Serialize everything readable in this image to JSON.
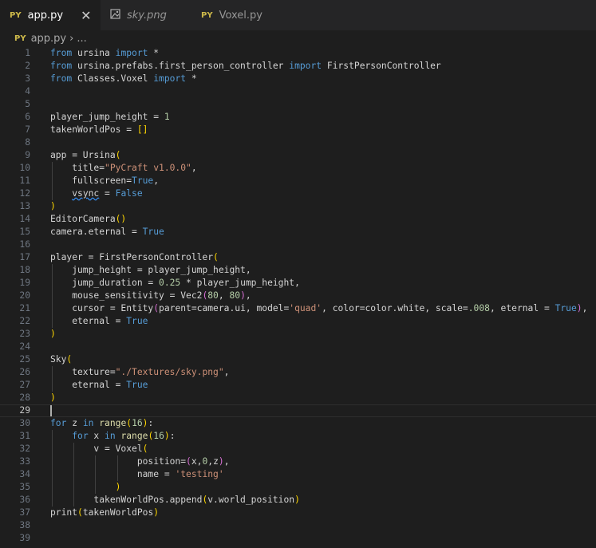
{
  "tabs": [
    {
      "icon": "PY",
      "label": "app.py",
      "active": true,
      "close": "✕"
    },
    {
      "icon": "image",
      "label": "sky.png",
      "active": false
    },
    {
      "icon": "PY",
      "label": "Voxel.py",
      "active": false
    }
  ],
  "breadcrumb": {
    "icon": "PY",
    "file": "app.py",
    "chevron": "›",
    "rest": "..."
  },
  "colors": {
    "keyword": "#569cd6",
    "string": "#ce9178",
    "number": "#b5cea8",
    "bracket": "#ffd700"
  },
  "current_line": 29,
  "lines": [
    {
      "n": "1",
      "tokens": [
        [
          "kw",
          "from"
        ],
        [
          "n",
          " ursina "
        ],
        [
          "kw",
          "import"
        ],
        [
          "n",
          " *"
        ]
      ]
    },
    {
      "n": "2",
      "tokens": [
        [
          "kw",
          "from"
        ],
        [
          "n",
          " ursina.prefabs.first_person_controller "
        ],
        [
          "kw",
          "import"
        ],
        [
          "n",
          " FirstPersonController"
        ]
      ]
    },
    {
      "n": "3",
      "tokens": [
        [
          "kw",
          "from"
        ],
        [
          "n",
          " Classes.Voxel "
        ],
        [
          "kw",
          "import"
        ],
        [
          "n",
          " *"
        ]
      ]
    },
    {
      "n": "4",
      "tokens": []
    },
    {
      "n": "5",
      "tokens": []
    },
    {
      "n": "6",
      "tokens": [
        [
          "n",
          "player_jump_height = "
        ],
        [
          "num",
          "1"
        ]
      ]
    },
    {
      "n": "7",
      "tokens": [
        [
          "n",
          "takenWorldPos = "
        ],
        [
          "p",
          "[]"
        ]
      ]
    },
    {
      "n": "8",
      "tokens": []
    },
    {
      "n": "9",
      "tokens": [
        [
          "n",
          "app = Ursina"
        ],
        [
          "p",
          "("
        ]
      ]
    },
    {
      "n": "10",
      "tokens": [
        [
          "n",
          "    title="
        ],
        [
          "str",
          "\"PyCraft v1.0.0\""
        ],
        [
          "n",
          ","
        ]
      ]
    },
    {
      "n": "11",
      "tokens": [
        [
          "n",
          "    fullscreen="
        ],
        [
          "kw",
          "True"
        ],
        [
          "n",
          ","
        ]
      ]
    },
    {
      "n": "12",
      "tokens": [
        [
          "n",
          "    "
        ],
        [
          "sq",
          "vsync"
        ],
        [
          "n",
          " = "
        ],
        [
          "kw",
          "False"
        ]
      ]
    },
    {
      "n": "13",
      "tokens": [
        [
          "p",
          ")"
        ]
      ]
    },
    {
      "n": "14",
      "tokens": [
        [
          "n",
          "EditorCamera"
        ],
        [
          "p",
          "()"
        ]
      ]
    },
    {
      "n": "15",
      "tokens": [
        [
          "n",
          "camera.eternal = "
        ],
        [
          "kw",
          "True"
        ]
      ]
    },
    {
      "n": "16",
      "tokens": []
    },
    {
      "n": "17",
      "tokens": [
        [
          "n",
          "player = FirstPersonController"
        ],
        [
          "p",
          "("
        ]
      ]
    },
    {
      "n": "18",
      "tokens": [
        [
          "n",
          "    jump_height = player_jump_height,"
        ]
      ]
    },
    {
      "n": "19",
      "tokens": [
        [
          "n",
          "    jump_duration = "
        ],
        [
          "num",
          "0.25"
        ],
        [
          "n",
          " * player_jump_height,"
        ]
      ]
    },
    {
      "n": "20",
      "tokens": [
        [
          "n",
          "    mouse_sensitivity = Vec2"
        ],
        [
          "p2",
          "("
        ],
        [
          "num",
          "80"
        ],
        [
          "n",
          ", "
        ],
        [
          "num",
          "80"
        ],
        [
          "p2",
          ")"
        ],
        [
          "n",
          ","
        ]
      ]
    },
    {
      "n": "21",
      "tokens": [
        [
          "n",
          "    cursor = Entity"
        ],
        [
          "p2",
          "("
        ],
        [
          "n",
          "parent=camera.ui, model="
        ],
        [
          "str",
          "'quad'"
        ],
        [
          "n",
          ", color=color.white, scale="
        ],
        [
          "num",
          ".008"
        ],
        [
          "n",
          ", eternal = "
        ],
        [
          "kw",
          "True"
        ],
        [
          "p2",
          ")"
        ],
        [
          "n",
          ","
        ]
      ]
    },
    {
      "n": "22",
      "tokens": [
        [
          "n",
          "    eternal = "
        ],
        [
          "kw",
          "True"
        ]
      ]
    },
    {
      "n": "23",
      "tokens": [
        [
          "p",
          ")"
        ]
      ]
    },
    {
      "n": "24",
      "tokens": []
    },
    {
      "n": "25",
      "tokens": [
        [
          "n",
          "Sky"
        ],
        [
          "p",
          "("
        ]
      ]
    },
    {
      "n": "26",
      "tokens": [
        [
          "n",
          "    texture="
        ],
        [
          "str",
          "\"./Textures/sky.png\""
        ],
        [
          "n",
          ","
        ]
      ]
    },
    {
      "n": "27",
      "tokens": [
        [
          "n",
          "    eternal = "
        ],
        [
          "kw",
          "True"
        ]
      ]
    },
    {
      "n": "28",
      "tokens": [
        [
          "p",
          ")"
        ]
      ]
    },
    {
      "n": "29",
      "tokens": []
    },
    {
      "n": "30",
      "tokens": [
        [
          "kw",
          "for"
        ],
        [
          "n",
          " z "
        ],
        [
          "kw",
          "in"
        ],
        [
          "n",
          " "
        ],
        [
          "fn",
          "range"
        ],
        [
          "p",
          "("
        ],
        [
          "num",
          "16"
        ],
        [
          "p",
          ")"
        ],
        [
          "n",
          ":"
        ]
      ]
    },
    {
      "n": "31",
      "tokens": [
        [
          "n",
          "    "
        ],
        [
          "kw",
          "for"
        ],
        [
          "n",
          " x "
        ],
        [
          "kw",
          "in"
        ],
        [
          "n",
          " "
        ],
        [
          "fn",
          "range"
        ],
        [
          "p",
          "("
        ],
        [
          "num",
          "16"
        ],
        [
          "p",
          ")"
        ],
        [
          "n",
          ":"
        ]
      ]
    },
    {
      "n": "32",
      "tokens": [
        [
          "n",
          "        v = Voxel"
        ],
        [
          "p",
          "("
        ]
      ]
    },
    {
      "n": "33",
      "tokens": [
        [
          "n",
          "                position="
        ],
        [
          "p2",
          "("
        ],
        [
          "n",
          "x,"
        ],
        [
          "num",
          "0"
        ],
        [
          "n",
          ",z"
        ],
        [
          "p2",
          ")"
        ],
        [
          "n",
          ","
        ]
      ]
    },
    {
      "n": "34",
      "tokens": [
        [
          "n",
          "                name = "
        ],
        [
          "str",
          "'testing'"
        ]
      ]
    },
    {
      "n": "35",
      "tokens": [
        [
          "n",
          "            "
        ],
        [
          "p",
          ")"
        ]
      ]
    },
    {
      "n": "36",
      "tokens": [
        [
          "n",
          "        takenWorldPos.append"
        ],
        [
          "p",
          "("
        ],
        [
          "n",
          "v.world_position"
        ],
        [
          "p",
          ")"
        ]
      ]
    },
    {
      "n": "37",
      "tokens": [
        [
          "n",
          "print"
        ],
        [
          "p",
          "("
        ],
        [
          "n",
          "takenWorldPos"
        ],
        [
          "p",
          ")"
        ]
      ]
    },
    {
      "n": "38",
      "tokens": []
    },
    {
      "n": "39",
      "tokens": []
    }
  ]
}
